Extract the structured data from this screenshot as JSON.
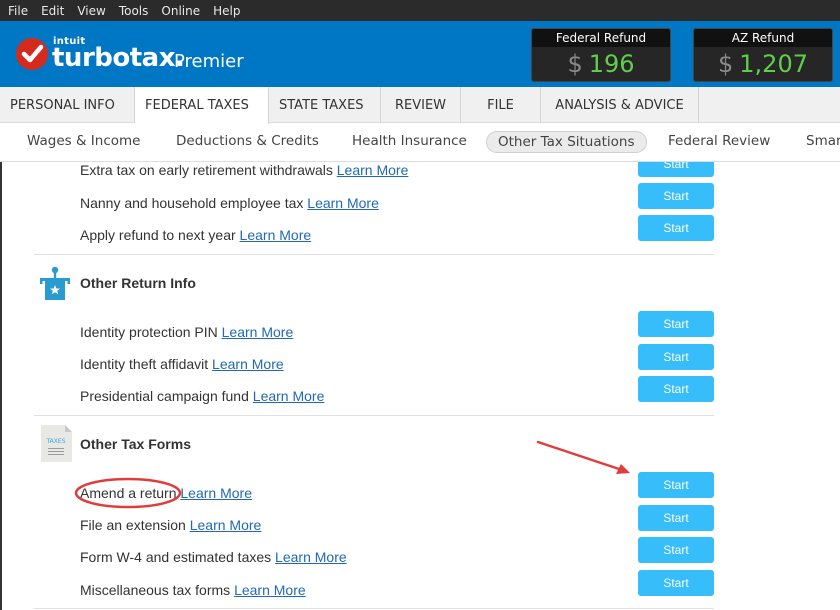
{
  "menubar": {
    "items": [
      "File",
      "Edit",
      "View",
      "Tools",
      "Online",
      "Help"
    ]
  },
  "header": {
    "brand_parent": "intuit",
    "brand": "turbotax.",
    "edition": "Premier",
    "refunds": [
      {
        "label": "Federal Refund",
        "currency": "$",
        "amount": "196"
      },
      {
        "label": "AZ Refund",
        "currency": "$",
        "amount": "1,207"
      }
    ]
  },
  "tabs": [
    {
      "label": "PERSONAL INFO",
      "active": false
    },
    {
      "label": "FEDERAL TAXES",
      "active": true
    },
    {
      "label": "STATE TAXES",
      "active": false
    },
    {
      "label": "REVIEW",
      "active": false
    },
    {
      "label": "FILE",
      "active": false
    },
    {
      "label": "ANALYSIS & ADVICE",
      "active": false
    }
  ],
  "subnav": [
    {
      "label": "Wages & Income",
      "active": false
    },
    {
      "label": "Deductions & Credits",
      "active": false
    },
    {
      "label": "Health Insurance",
      "active": false
    },
    {
      "label": "Other Tax Situations",
      "active": true
    },
    {
      "label": "Federal Review",
      "active": false
    },
    {
      "label": "Smart",
      "active": false
    }
  ],
  "learn_more": "Learn More",
  "start_label": "Start",
  "sections": [
    {
      "title": null,
      "items": [
        "Extra tax on early retirement withdrawals",
        "Nanny and household employee tax",
        "Apply refund to next year"
      ]
    },
    {
      "title": "Other Return Info",
      "icon": "ballot-box-icon",
      "items": [
        "Identity protection PIN",
        "Identity theft affidavit",
        "Presidential campaign fund"
      ]
    },
    {
      "title": "Other Tax Forms",
      "icon": "tax-document-icon",
      "icon_text": "TAXES",
      "items": [
        "Amend a return",
        "File an extension",
        "Form W-4 and estimated taxes",
        "Miscellaneous tax forms"
      ]
    }
  ],
  "colors": {
    "brand_blue": "#0077c5",
    "start_button": "#36bdfa",
    "refund_green": "#5fcf4a",
    "link": "#2169b4",
    "annotation_red": "#e03c3c"
  }
}
